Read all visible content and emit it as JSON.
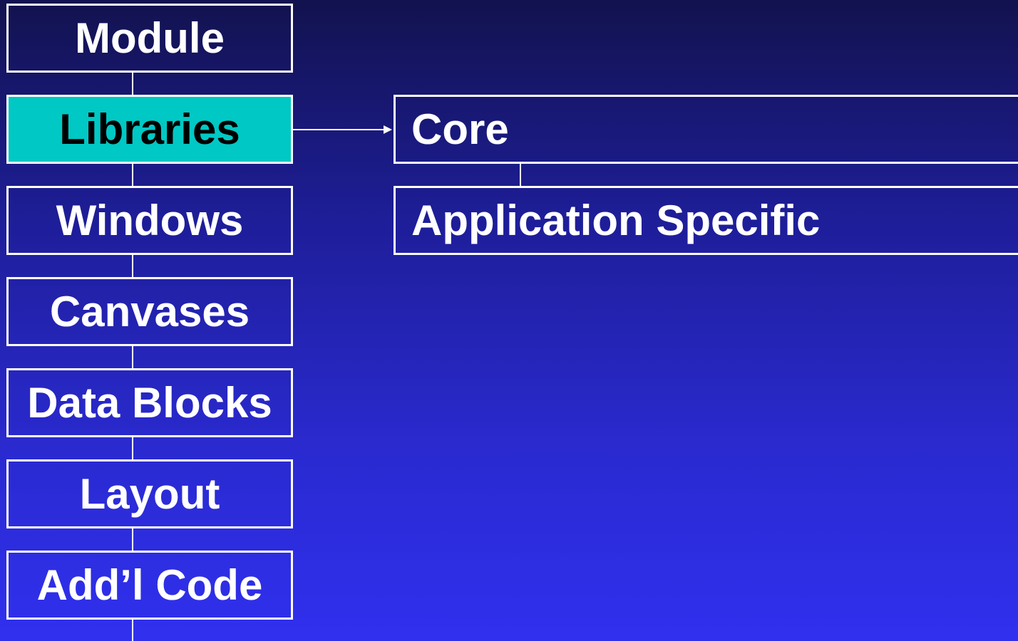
{
  "modules": {
    "module": "Module",
    "libraries": "Libraries",
    "windows": "Windows",
    "canvases": "Canvases",
    "data_blocks": "Data Blocks",
    "layout": "Layout",
    "addl_code": "Add’l Code"
  },
  "libraries_detail": {
    "core": "Core",
    "application_specific": "Application Specific"
  },
  "colors": {
    "highlight": "#00c8c4",
    "border": "#ffffff",
    "background_top": "#12124f",
    "background_bottom": "#3030ef"
  }
}
